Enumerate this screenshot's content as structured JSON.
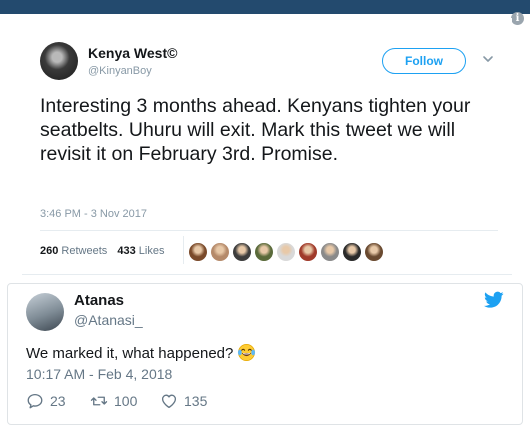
{
  "embedded_tweet": {
    "author_name": "Kenya West©",
    "author_handle": "@KinyanBoy",
    "follow_label": "Follow",
    "text": "Interesting 3 months ahead. Kenyans tighten your seatbelts. Uhuru will exit. Mark this tweet we will revisit it on February 3rd. Promise.",
    "timestamp": "3:46 PM - 3 Nov 2017",
    "retweets_count": "260",
    "retweets_label": "Retweets",
    "likes_count": "433",
    "likes_label": "Likes",
    "liker_avatar_count": 9
  },
  "reply": {
    "author_name": "Atanas",
    "author_handle": "@Atanasi_",
    "text": "We marked it, what happened?",
    "emoji": "face-with-tears-of-joy-icon",
    "timestamp": "10:17 AM - Feb 4, 2018",
    "replies_count": "23",
    "retweets_count": "100",
    "likes_count": "135"
  },
  "colors": {
    "header_bar": "#234a6e",
    "twitter_blue": "#1da1f2",
    "text": "#14171a",
    "secondary_text": "#657786"
  },
  "icons": [
    "info-icon",
    "chevron-down-icon",
    "twitter-bird-icon",
    "reply-icon",
    "retweet-icon",
    "heart-icon"
  ]
}
